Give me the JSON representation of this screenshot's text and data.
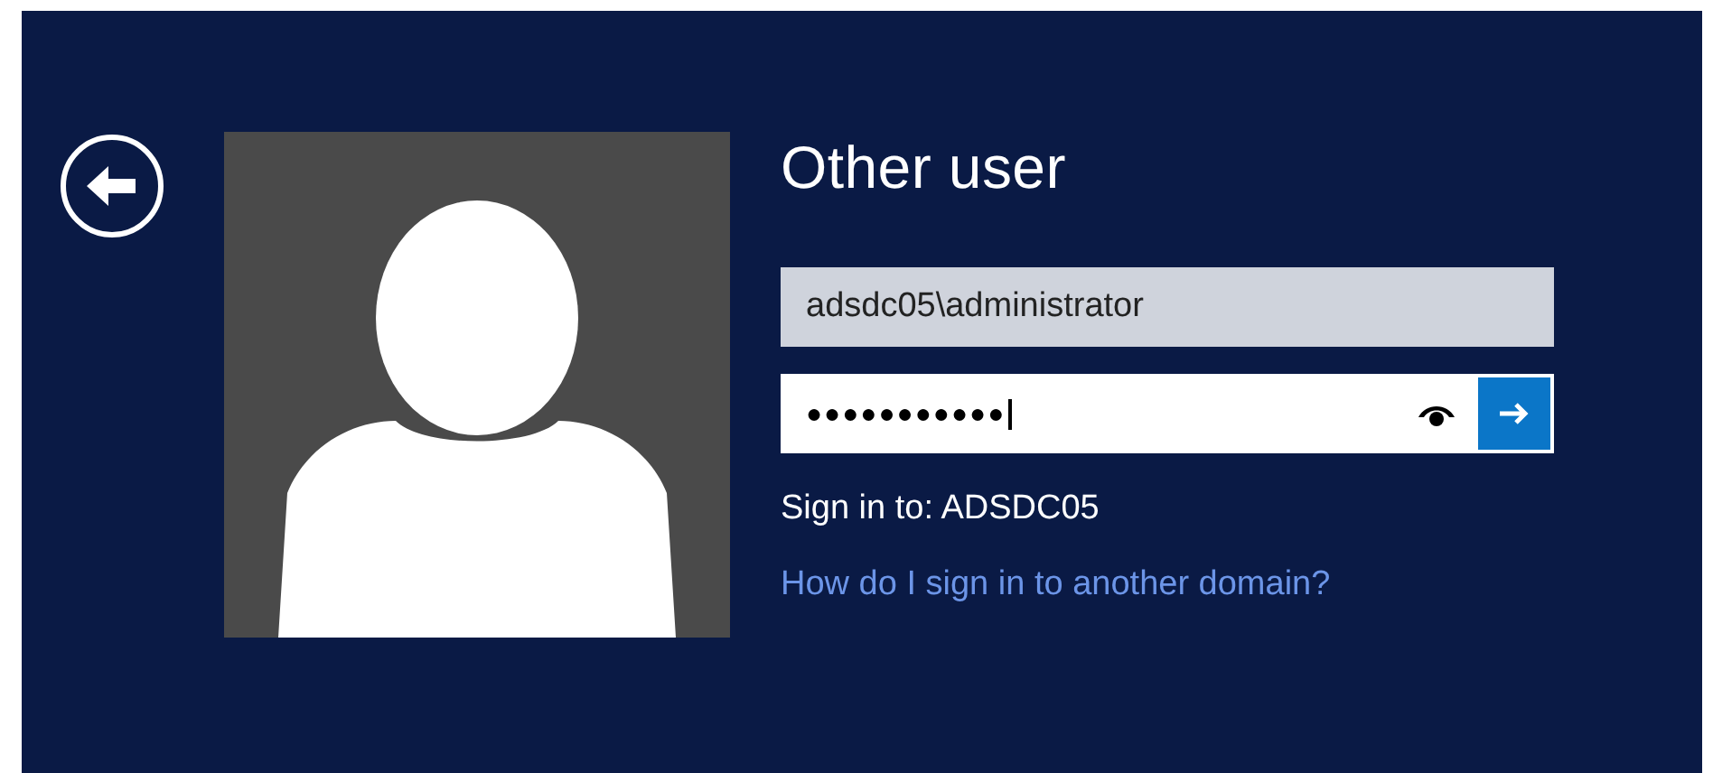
{
  "title": "Other user",
  "username_field": {
    "value": "adsdc05\\administrator"
  },
  "password_field": {
    "value": "●●●●●●●●●●●",
    "focused": true
  },
  "sign_in_to": "Sign in to: ADSDC05",
  "link": "How do I sign in to another domain?"
}
